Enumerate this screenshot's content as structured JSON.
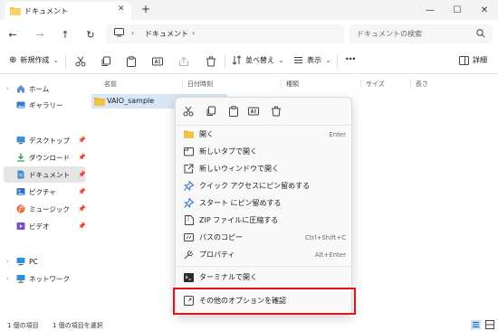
{
  "window": {
    "tab_title": "ドキュメント",
    "close_tab_glyph": "✕",
    "new_tab_glyph": "+",
    "minimize_glyph": "—",
    "maximize_glyph": "☐",
    "close_glyph": "✕"
  },
  "nav": {
    "back_glyph": "←",
    "forward_glyph": "→",
    "up_glyph": "↑",
    "refresh_glyph": "↻",
    "breadcrumb_sep": "›",
    "breadcrumb_current": "ドキュメント",
    "breadcrumb_trailing": "›",
    "search_placeholder": "ドキュメントの検索"
  },
  "toolbar": {
    "new_label": "新規作成",
    "new_glyph": "⊕",
    "dropdown_glyph": "⌄",
    "sort_label": "並べ替え",
    "view_label": "表示",
    "more_glyph": "•••",
    "details_label": "詳細"
  },
  "sidebar": {
    "home": "ホーム",
    "gallery": "ギャラリー",
    "desktop": "デスクトップ",
    "downloads": "ダウンロード",
    "documents": "ドキュメント",
    "pictures": "ピクチャ",
    "music": "ミュージック",
    "videos": "ビデオ",
    "pc": "PC",
    "network": "ネットワーク",
    "pin_glyph": "📌",
    "chevron_glyph": "›"
  },
  "columns": [
    "名前",
    "日付時刻",
    "種類",
    "サイズ",
    "長さ"
  ],
  "files": [
    {
      "name": "VAIO_sample"
    }
  ],
  "context_menu": {
    "items": [
      {
        "label": "開く",
        "shortcut": "Enter"
      },
      {
        "label": "新しいタブで開く",
        "shortcut": ""
      },
      {
        "label": "新しいウィンドウで開く",
        "shortcut": ""
      },
      {
        "label": "クイック アクセスにピン留めする",
        "shortcut": ""
      },
      {
        "label": "スタート にピン留めする",
        "shortcut": ""
      },
      {
        "label": "ZIP ファイルに圧縮する",
        "shortcut": ""
      },
      {
        "label": "パスのコピー",
        "shortcut": "Ctrl+Shift+C"
      },
      {
        "label": "プロパティ",
        "shortcut": "Alt+Enter"
      },
      {
        "label": "ターミナルで開く",
        "shortcut": ""
      },
      {
        "label": "その他のオプションを確認",
        "shortcut": ""
      }
    ]
  },
  "status": {
    "count": "1 個の項目",
    "selected": "1 個の項目を選択"
  },
  "colors": {
    "accent": "#0067c0",
    "folder": "#f5c344",
    "highlight_box": "#e0141e",
    "selection": "#d8e6f7"
  }
}
